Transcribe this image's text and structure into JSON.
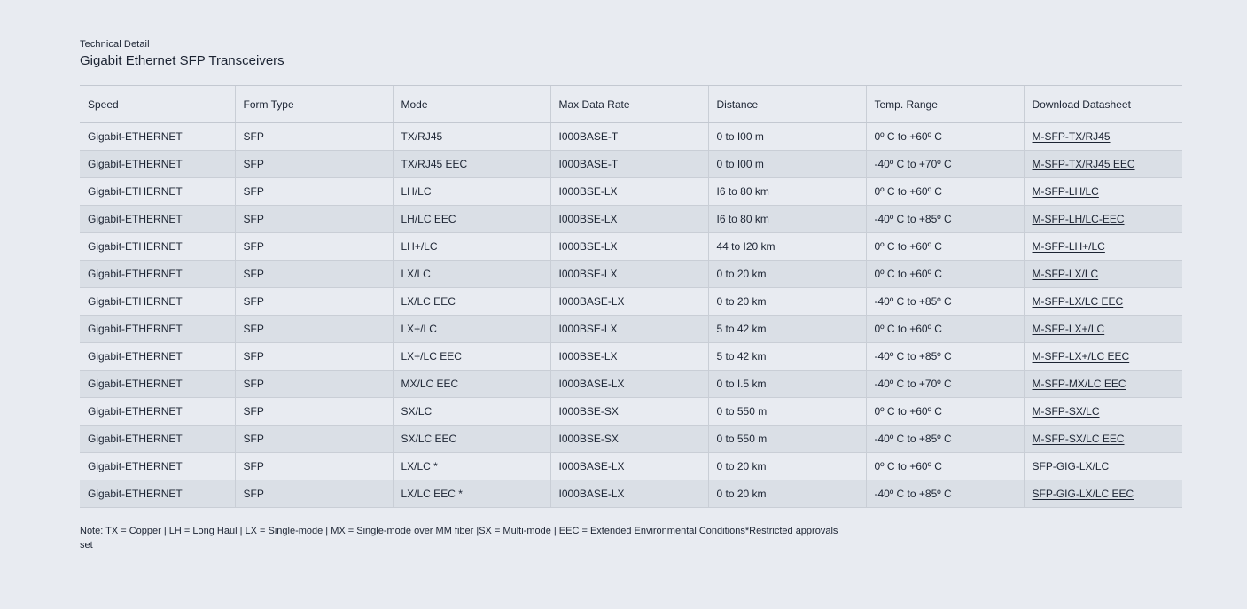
{
  "header": {
    "eyebrow": "Technical Detail",
    "title": "Gigabit Ethernet SFP Transceivers"
  },
  "table": {
    "columns": [
      "Speed",
      "Form Type",
      "Mode",
      "Max Data Rate",
      "Distance",
      "Temp. Range",
      "Download Datasheet"
    ],
    "rows": [
      [
        "Gigabit-ETHERNET",
        "SFP",
        "TX/RJ45",
        "I000BASE-T",
        "0 to I00 m",
        "0º C to +60º C",
        "M-SFP-TX/RJ45"
      ],
      [
        "Gigabit-ETHERNET",
        "SFP",
        "TX/RJ45 EEC",
        "I000BASE-T",
        "0 to I00 m",
        "-40º C to +70º C",
        "M-SFP-TX/RJ45 EEC"
      ],
      [
        "Gigabit-ETHERNET",
        "SFP",
        "LH/LC",
        "I000BSE-LX",
        "I6 to 80 km",
        "0º C to +60º C",
        "M-SFP-LH/LC"
      ],
      [
        "Gigabit-ETHERNET",
        "SFP",
        "LH/LC EEC",
        "I000BSE-LX",
        "I6 to 80 km",
        "-40º C to +85º C",
        "M-SFP-LH/LC-EEC"
      ],
      [
        "Gigabit-ETHERNET",
        "SFP",
        "LH+/LC",
        "I000BSE-LX",
        "44 to I20 km",
        "0º C to +60º C",
        "M-SFP-LH+/LC"
      ],
      [
        "Gigabit-ETHERNET",
        "SFP",
        "LX/LC",
        "I000BSE-LX",
        "0 to 20 km",
        "0º C to +60º C",
        "M-SFP-LX/LC"
      ],
      [
        "Gigabit-ETHERNET",
        "SFP",
        "LX/LC EEC",
        "I000BASE-LX",
        "0 to 20 km",
        "-40º C to +85º C",
        "M-SFP-LX/LC EEC"
      ],
      [
        "Gigabit-ETHERNET",
        "SFP",
        "LX+/LC",
        "I000BSE-LX",
        "5 to 42 km",
        "0º C to +60º C",
        "M-SFP-LX+/LC"
      ],
      [
        "Gigabit-ETHERNET",
        "SFP",
        "LX+/LC EEC",
        "I000BSE-LX",
        "5 to 42 km",
        "-40º C to +85º C",
        "M-SFP-LX+/LC EEC"
      ],
      [
        "Gigabit-ETHERNET",
        "SFP",
        "MX/LC EEC",
        "I000BASE-LX",
        "0 to I.5 km",
        "-40º C to +70º C",
        "M-SFP-MX/LC EEC"
      ],
      [
        "Gigabit-ETHERNET",
        "SFP",
        "SX/LC",
        "I000BSE-SX",
        "0 to 550 m",
        "0º C to +60º C",
        "M-SFP-SX/LC"
      ],
      [
        "Gigabit-ETHERNET",
        "SFP",
        "SX/LC EEC",
        "I000BSE-SX",
        "0 to 550 m",
        "-40º C to +85º C",
        "M-SFP-SX/LC EEC"
      ],
      [
        "Gigabit-ETHERNET",
        "SFP",
        "LX/LC *",
        "I000BASE-LX",
        "0 to 20 km",
        "0º C to +60º C",
        "SFP-GIG-LX/LC"
      ],
      [
        "Gigabit-ETHERNET",
        "SFP",
        "LX/LC EEC *",
        "I000BASE-LX",
        "0 to 20 km",
        "-40º C to +85º C",
        "SFP-GIG-LX/LC EEC"
      ]
    ]
  },
  "note": "Note: TX = Copper | LH = Long Haul | LX = Single-mode | MX = Single-mode over MM fiber |SX = Multi-mode | EEC = Extended Environmental Conditions*Restricted approvals set",
  "colors": {
    "background": "#e8ebf1",
    "row_alt": "#dadfe6",
    "text": "#1c2433",
    "border": "#c9ced6"
  }
}
